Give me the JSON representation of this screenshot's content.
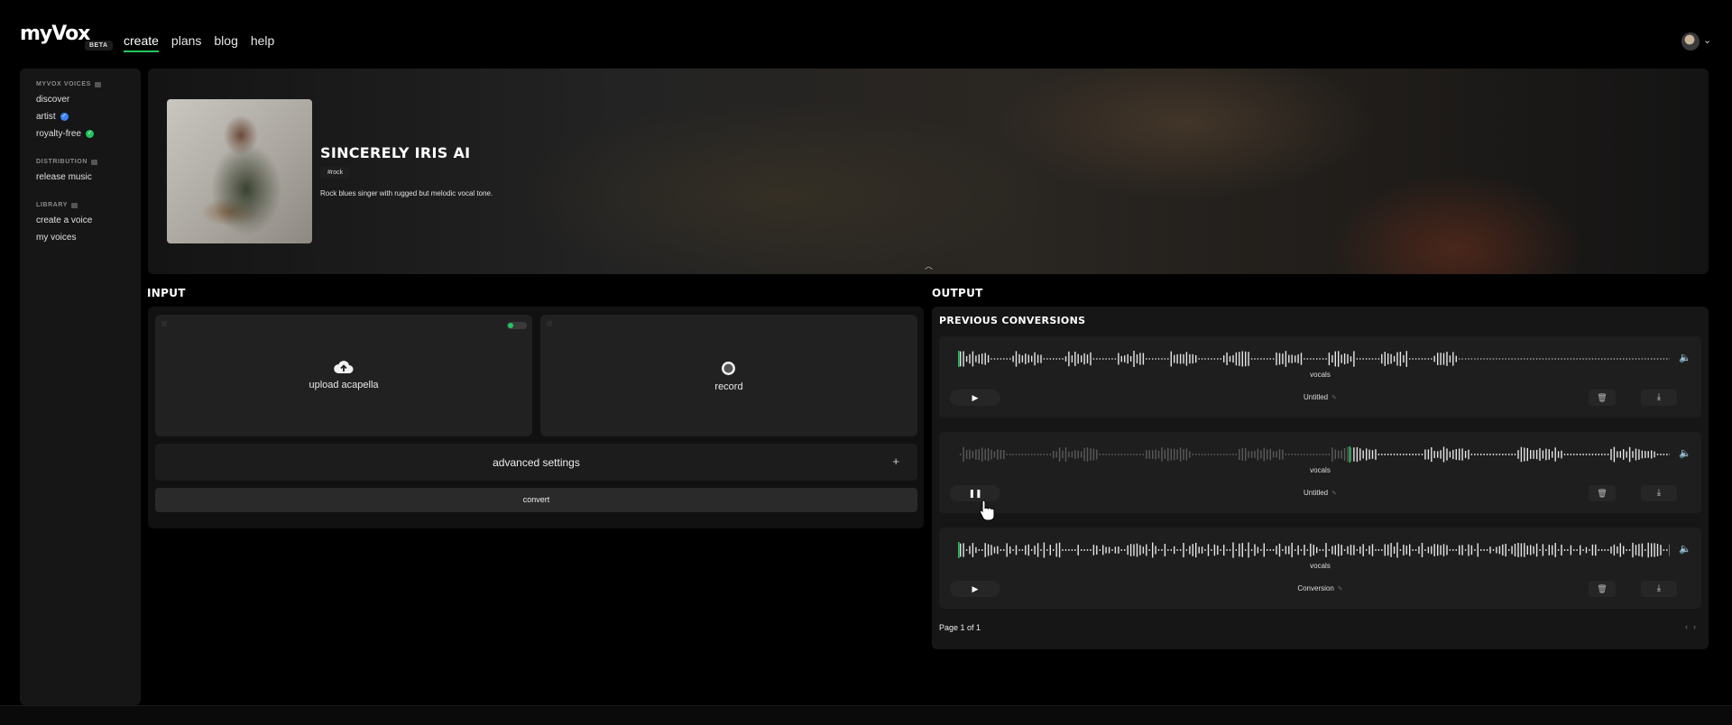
{
  "app": {
    "logo_text": "myVox",
    "badge": "BETA"
  },
  "nav": {
    "create": "create",
    "plans": "plans",
    "blog": "blog",
    "help": "help",
    "active": "create"
  },
  "sidebar": {
    "voices_section": "MYVOX VOICES",
    "discover": "discover",
    "artist": "artist",
    "royalty_free": "royalty-free",
    "distribution_section": "DISTRIBUTION",
    "release_music": "release music",
    "library_section": "LIBRARY",
    "create_voice": "create a voice",
    "my_voices": "my voices"
  },
  "voice": {
    "name": "SINCERELY IRIS AI",
    "tag": "#rock",
    "description": "Rock blues singer with rugged but melodic vocal tone."
  },
  "input": {
    "heading": "INPUT",
    "upload_label": "upload acapella",
    "record_label": "record",
    "advanced_label": "advanced settings",
    "advanced_plus": "+",
    "convert_label": "convert"
  },
  "output": {
    "heading": "OUTPUT",
    "previous_title": "PREVIOUS CONVERSIONS",
    "conversions": [
      {
        "track_label": "vocals",
        "name": "Untitled",
        "playing": false,
        "progress": 0.0
      },
      {
        "track_label": "vocals",
        "name": "Untitled",
        "playing": true,
        "progress": 0.55
      },
      {
        "track_label": "vocals",
        "name": "Conversion",
        "playing": false,
        "progress": 0.0
      }
    ],
    "page_info": "Page 1 of 1"
  },
  "colors": {
    "accent": "#22c55e",
    "badge_blue": "#3b82f6",
    "panel": "#161616",
    "card": "#212121"
  },
  "icons": {
    "upload": "cloud-upload-icon",
    "record": "record-icon",
    "play": "play-icon",
    "pause": "pause-icon",
    "trash": "trash-icon",
    "download": "download-icon",
    "volume": "volume-icon"
  }
}
